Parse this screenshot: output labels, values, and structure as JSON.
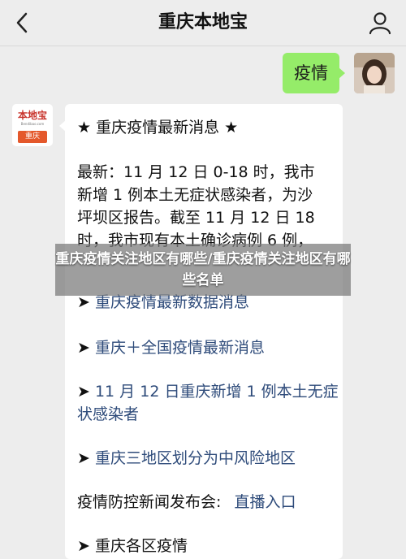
{
  "header": {
    "title": "重庆本地宝",
    "back_icon": "chevron-left-icon",
    "profile_icon": "person-icon"
  },
  "my_message": {
    "text": "疫情",
    "avatar": "user-avatar"
  },
  "official_account": {
    "logo_name": "本地宝",
    "logo_url": "Bendibao.com",
    "logo_city": "重庆"
  },
  "card": {
    "title": "★ 重庆疫情最新消息 ★",
    "body": "最新：11 月 12 日 0-18 时，我市\n新增 1 例本土无症状感染者，为沙\n坪坝区报告。截至 11 月 12 日 18\n时，我市现有本土确诊病例 6 例，",
    "links": [
      {
        "arrow": "➤",
        "text": "重庆疫情最新数据消息"
      },
      {
        "arrow": "➤",
        "text": "重庆＋全国疫情最新消息"
      },
      {
        "arrow": "➤",
        "text": "11 月 12 日重庆新增 1 例本土无症状感染者"
      },
      {
        "arrow": "➤",
        "text": "重庆三地区划分为中风险地区"
      }
    ],
    "footer_label": "疫情防控新闻发布会:",
    "footer_link": "直播入口",
    "cut_text": "➤ 重庆各区疫情"
  },
  "overlay": {
    "text": "重庆疫情关注地区有哪些/重庆疫情关注地区有哪些名单"
  },
  "colors": {
    "background": "#ededed",
    "bubble_green": "#95ec69",
    "link_blue": "#2e4b7a"
  }
}
